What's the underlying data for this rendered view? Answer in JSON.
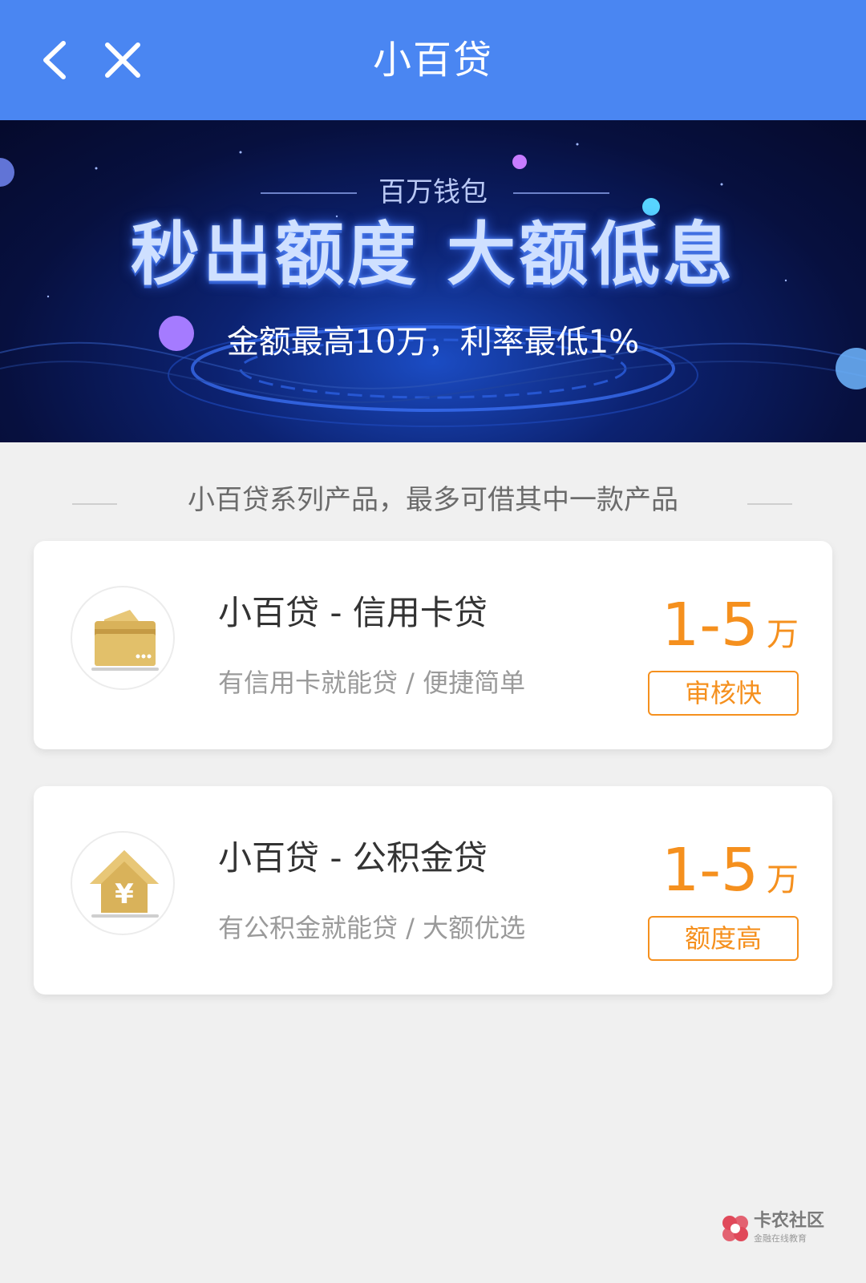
{
  "header": {
    "title": "小百贷",
    "back_icon": "chevron-left-icon",
    "close_icon": "close-icon"
  },
  "banner": {
    "small_title": "百万钱包",
    "main_title": "秒出额度  大额低息",
    "subtitle": "金额最高10万，利率最低1%"
  },
  "section": {
    "caption": "小百贷系列产品，最多可借其中一款产品"
  },
  "products": [
    {
      "title": "小百贷 - 信用卡贷",
      "desc": "有信用卡就能贷 / 便捷简单",
      "amount": "1-5",
      "unit": "万",
      "tag": "审核快",
      "icon": "credit-card-icon"
    },
    {
      "title": "小百贷 - 公积金贷",
      "desc": "有公积金就能贷 / 大额优选",
      "amount": "1-5",
      "unit": "万",
      "tag": "额度高",
      "icon": "house-yuan-icon"
    }
  ],
  "watermark": {
    "name": "卡农社区",
    "tagline": "金融在线教育"
  },
  "colors": {
    "header_bg": "#4a86f2",
    "accent_orange": "#f5901e",
    "page_bg": "#f0f0f0",
    "icon_gold": "#d9b25a"
  }
}
